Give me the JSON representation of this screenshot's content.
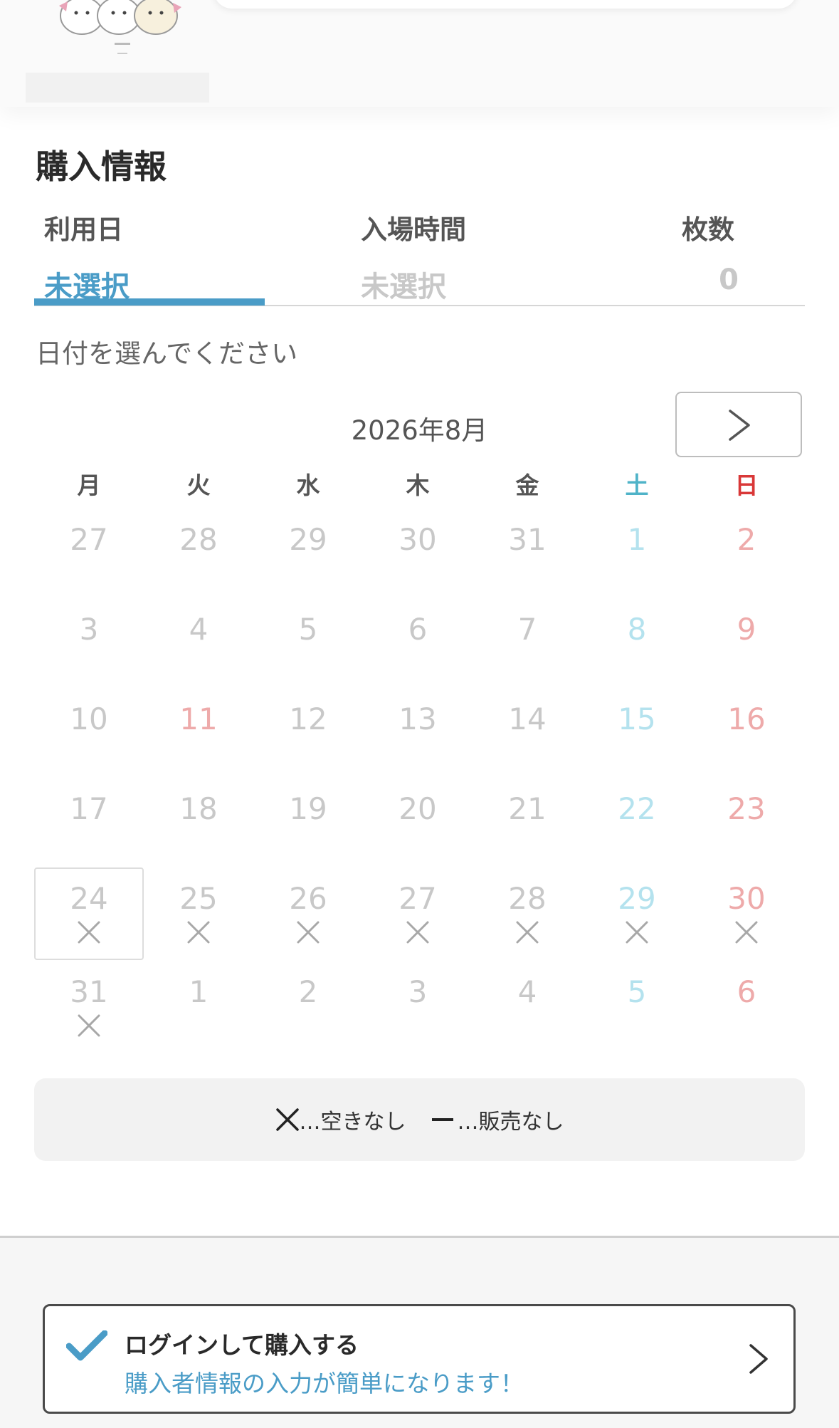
{
  "section_title": "購入情報",
  "tabs": [
    {
      "label": "利用日",
      "value": "未選択"
    },
    {
      "label": "入場時間",
      "value": "未選択"
    },
    {
      "label": "枚数",
      "value": "0"
    }
  ],
  "prompt": "日付を選んでください",
  "calendar": {
    "month_title": "2026年8月",
    "weekdays": [
      "月",
      "火",
      "水",
      "木",
      "金",
      "土",
      "日"
    ],
    "weeks": [
      [
        {
          "d": "27",
          "s": ""
        },
        {
          "d": "28",
          "s": ""
        },
        {
          "d": "29",
          "s": ""
        },
        {
          "d": "30",
          "s": ""
        },
        {
          "d": "31",
          "s": ""
        },
        {
          "d": "1",
          "s": ""
        },
        {
          "d": "2",
          "s": ""
        }
      ],
      [
        {
          "d": "3",
          "s": ""
        },
        {
          "d": "4",
          "s": ""
        },
        {
          "d": "5",
          "s": ""
        },
        {
          "d": "6",
          "s": ""
        },
        {
          "d": "7",
          "s": ""
        },
        {
          "d": "8",
          "s": ""
        },
        {
          "d": "9",
          "s": ""
        }
      ],
      [
        {
          "d": "10",
          "s": ""
        },
        {
          "d": "11",
          "s": "",
          "holiday": true
        },
        {
          "d": "12",
          "s": ""
        },
        {
          "d": "13",
          "s": ""
        },
        {
          "d": "14",
          "s": ""
        },
        {
          "d": "15",
          "s": ""
        },
        {
          "d": "16",
          "s": ""
        }
      ],
      [
        {
          "d": "17",
          "s": ""
        },
        {
          "d": "18",
          "s": ""
        },
        {
          "d": "19",
          "s": ""
        },
        {
          "d": "20",
          "s": ""
        },
        {
          "d": "21",
          "s": ""
        },
        {
          "d": "22",
          "s": ""
        },
        {
          "d": "23",
          "s": ""
        }
      ],
      [
        {
          "d": "24",
          "s": "x",
          "selected": true
        },
        {
          "d": "25",
          "s": "x"
        },
        {
          "d": "26",
          "s": "x"
        },
        {
          "d": "27",
          "s": "x"
        },
        {
          "d": "28",
          "s": "x"
        },
        {
          "d": "29",
          "s": "x"
        },
        {
          "d": "30",
          "s": "x"
        }
      ],
      [
        {
          "d": "31",
          "s": "x"
        },
        {
          "d": "1",
          "s": ""
        },
        {
          "d": "2",
          "s": ""
        },
        {
          "d": "3",
          "s": ""
        },
        {
          "d": "4",
          "s": ""
        },
        {
          "d": "5",
          "s": ""
        },
        {
          "d": "6",
          "s": ""
        }
      ]
    ]
  },
  "legend": {
    "sold_out": "…空きなし",
    "not_on_sale": "…販売なし"
  },
  "login": {
    "title": "ログインして購入する",
    "subtitle": "購入者情報の入力が簡単になります！"
  },
  "colors": {
    "accent": "#4a9cc7",
    "saturday": "#b4e2ee",
    "sunday": "#eeaaaa",
    "inactive": "#c8c8c8"
  },
  "icons": {
    "next": "chevron-right-icon",
    "sold_out": "x-mark-icon",
    "not_on_sale": "dash-icon",
    "login_check": "check-icon",
    "login_go": "chevron-right-icon"
  }
}
